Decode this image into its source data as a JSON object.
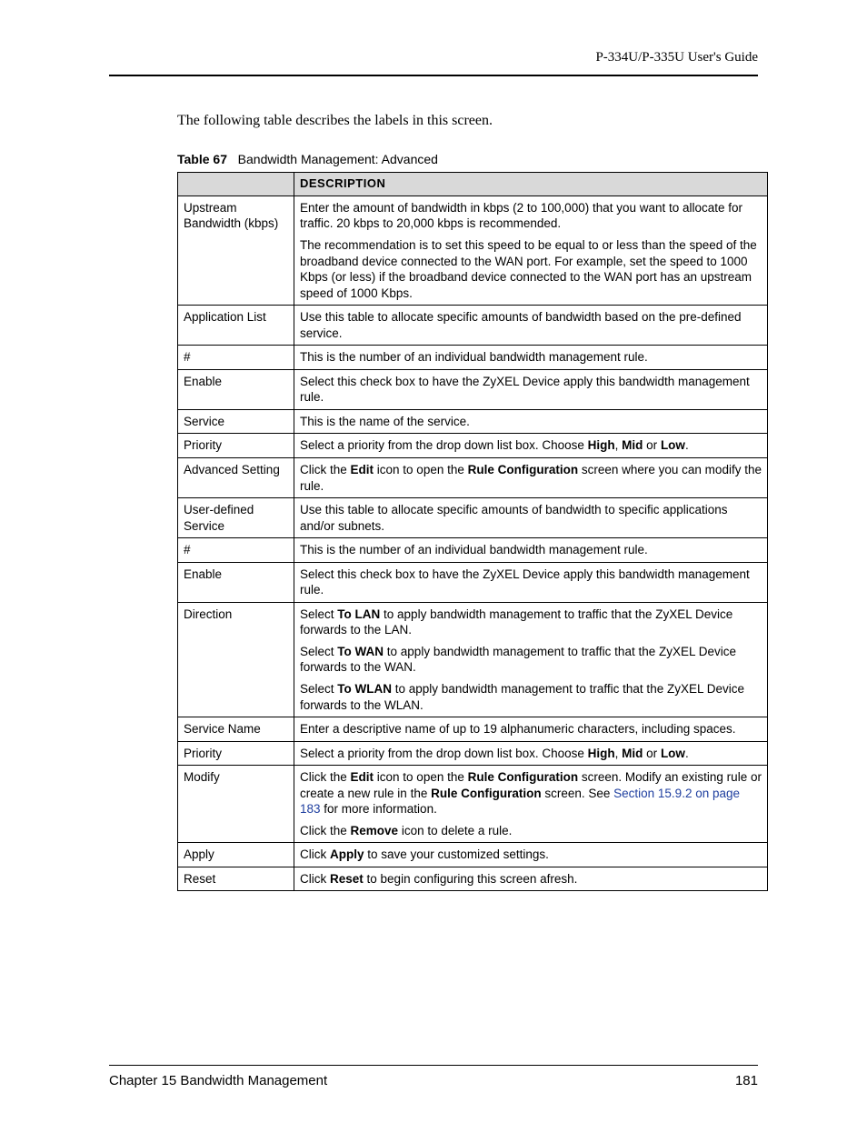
{
  "header": {
    "guide_title": "P-334U/P-335U User's Guide"
  },
  "intro_text": "The following table describes the labels in this screen.",
  "table_caption": {
    "label": "Table 67",
    "text": "Bandwidth Management: Advanced"
  },
  "table": {
    "header_blank": "",
    "header_desc": "DESCRIPTION",
    "rows": [
      {
        "label": "Upstream Bandwidth (kbps)",
        "desc": [
          [
            {
              "t": "plain",
              "v": "Enter the amount of bandwidth in kbps (2 to 100,000) that you want to allocate for traffic. 20 kbps to 20,000 kbps is recommended."
            }
          ],
          [
            {
              "t": "plain",
              "v": "The recommendation is to set this speed to be equal to or less than the speed of the broadband device connected to the WAN port. For example, set the speed to 1000 Kbps (or less) if the broadband device connected to the WAN port has an upstream speed of 1000 Kbps."
            }
          ]
        ]
      },
      {
        "label": "Application List",
        "desc": [
          [
            {
              "t": "plain",
              "v": "Use this table to allocate specific amounts of bandwidth based on the pre-defined service."
            }
          ]
        ]
      },
      {
        "label": "#",
        "desc": [
          [
            {
              "t": "plain",
              "v": "This is the number of an individual bandwidth management rule."
            }
          ]
        ]
      },
      {
        "label": "Enable",
        "desc": [
          [
            {
              "t": "plain",
              "v": "Select this check box to have the ZyXEL Device apply this bandwidth management rule."
            }
          ]
        ]
      },
      {
        "label": "Service",
        "desc": [
          [
            {
              "t": "plain",
              "v": "This is the name of the service."
            }
          ]
        ]
      },
      {
        "label": "Priority",
        "desc": [
          [
            {
              "t": "plain",
              "v": "Select a priority from the drop down list box. Choose "
            },
            {
              "t": "bold",
              "v": "High"
            },
            {
              "t": "plain",
              "v": ", "
            },
            {
              "t": "bold",
              "v": "Mid"
            },
            {
              "t": "plain",
              "v": " or "
            },
            {
              "t": "bold",
              "v": "Low"
            },
            {
              "t": "plain",
              "v": "."
            }
          ]
        ]
      },
      {
        "label": "Advanced Setting",
        "desc": [
          [
            {
              "t": "plain",
              "v": "Click the "
            },
            {
              "t": "bold",
              "v": "Edit"
            },
            {
              "t": "plain",
              "v": " icon to open the "
            },
            {
              "t": "bold",
              "v": "Rule Configuration"
            },
            {
              "t": "plain",
              "v": " screen where you can modify the rule."
            }
          ]
        ]
      },
      {
        "label": "User-defined Service",
        "desc": [
          [
            {
              "t": "plain",
              "v": "Use this table to allocate specific amounts of bandwidth to specific applications and/or subnets."
            }
          ]
        ]
      },
      {
        "label": "#",
        "desc": [
          [
            {
              "t": "plain",
              "v": "This is the number of an individual bandwidth management rule."
            }
          ]
        ]
      },
      {
        "label": "Enable",
        "desc": [
          [
            {
              "t": "plain",
              "v": "Select this check box to have the ZyXEL Device apply this bandwidth management rule."
            }
          ]
        ]
      },
      {
        "label": "Direction",
        "desc": [
          [
            {
              "t": "plain",
              "v": "Select "
            },
            {
              "t": "bold",
              "v": "To LAN"
            },
            {
              "t": "plain",
              "v": " to apply bandwidth management to traffic that the ZyXEL Device forwards to the LAN."
            }
          ],
          [
            {
              "t": "plain",
              "v": "Select "
            },
            {
              "t": "bold",
              "v": "To WAN"
            },
            {
              "t": "plain",
              "v": " to apply bandwidth management to traffic that the ZyXEL Device forwards to the WAN."
            }
          ],
          [
            {
              "t": "plain",
              "v": "Select "
            },
            {
              "t": "bold",
              "v": "To WLAN"
            },
            {
              "t": "plain",
              "v": " to apply bandwidth management to traffic that the ZyXEL Device forwards to the WLAN."
            }
          ]
        ]
      },
      {
        "label": "Service Name",
        "desc": [
          [
            {
              "t": "plain",
              "v": "Enter a descriptive name of up to 19 alphanumeric characters, including spaces."
            }
          ]
        ]
      },
      {
        "label": "Priority",
        "desc": [
          [
            {
              "t": "plain",
              "v": "Select a priority from the drop down list box. Choose "
            },
            {
              "t": "bold",
              "v": "High"
            },
            {
              "t": "plain",
              "v": ", "
            },
            {
              "t": "bold",
              "v": "Mid"
            },
            {
              "t": "plain",
              "v": " or "
            },
            {
              "t": "bold",
              "v": "Low"
            },
            {
              "t": "plain",
              "v": "."
            }
          ]
        ]
      },
      {
        "label": "Modify",
        "desc": [
          [
            {
              "t": "plain",
              "v": "Click the "
            },
            {
              "t": "bold",
              "v": "Edit"
            },
            {
              "t": "plain",
              "v": " icon to open the "
            },
            {
              "t": "bold",
              "v": "Rule Configuration"
            },
            {
              "t": "plain",
              "v": " screen. Modify an existing rule or create a new rule in the "
            },
            {
              "t": "bold",
              "v": "Rule Configuration"
            },
            {
              "t": "plain",
              "v": " screen. See "
            },
            {
              "t": "link",
              "v": "Section 15.9.2 on page 183"
            },
            {
              "t": "plain",
              "v": " for more information."
            }
          ],
          [
            {
              "t": "plain",
              "v": "Click the "
            },
            {
              "t": "bold",
              "v": "Remove"
            },
            {
              "t": "plain",
              "v": " icon to delete a rule."
            }
          ]
        ]
      },
      {
        "label": "Apply",
        "desc": [
          [
            {
              "t": "plain",
              "v": "Click "
            },
            {
              "t": "bold",
              "v": "Apply"
            },
            {
              "t": "plain",
              "v": " to save your customized settings."
            }
          ]
        ]
      },
      {
        "label": "Reset",
        "desc": [
          [
            {
              "t": "plain",
              "v": "Click "
            },
            {
              "t": "bold",
              "v": "Reset"
            },
            {
              "t": "plain",
              "v": " to begin configuring this screen afresh."
            }
          ]
        ]
      }
    ]
  },
  "footer": {
    "chapter": "Chapter 15 Bandwidth Management",
    "page_number": "181"
  }
}
